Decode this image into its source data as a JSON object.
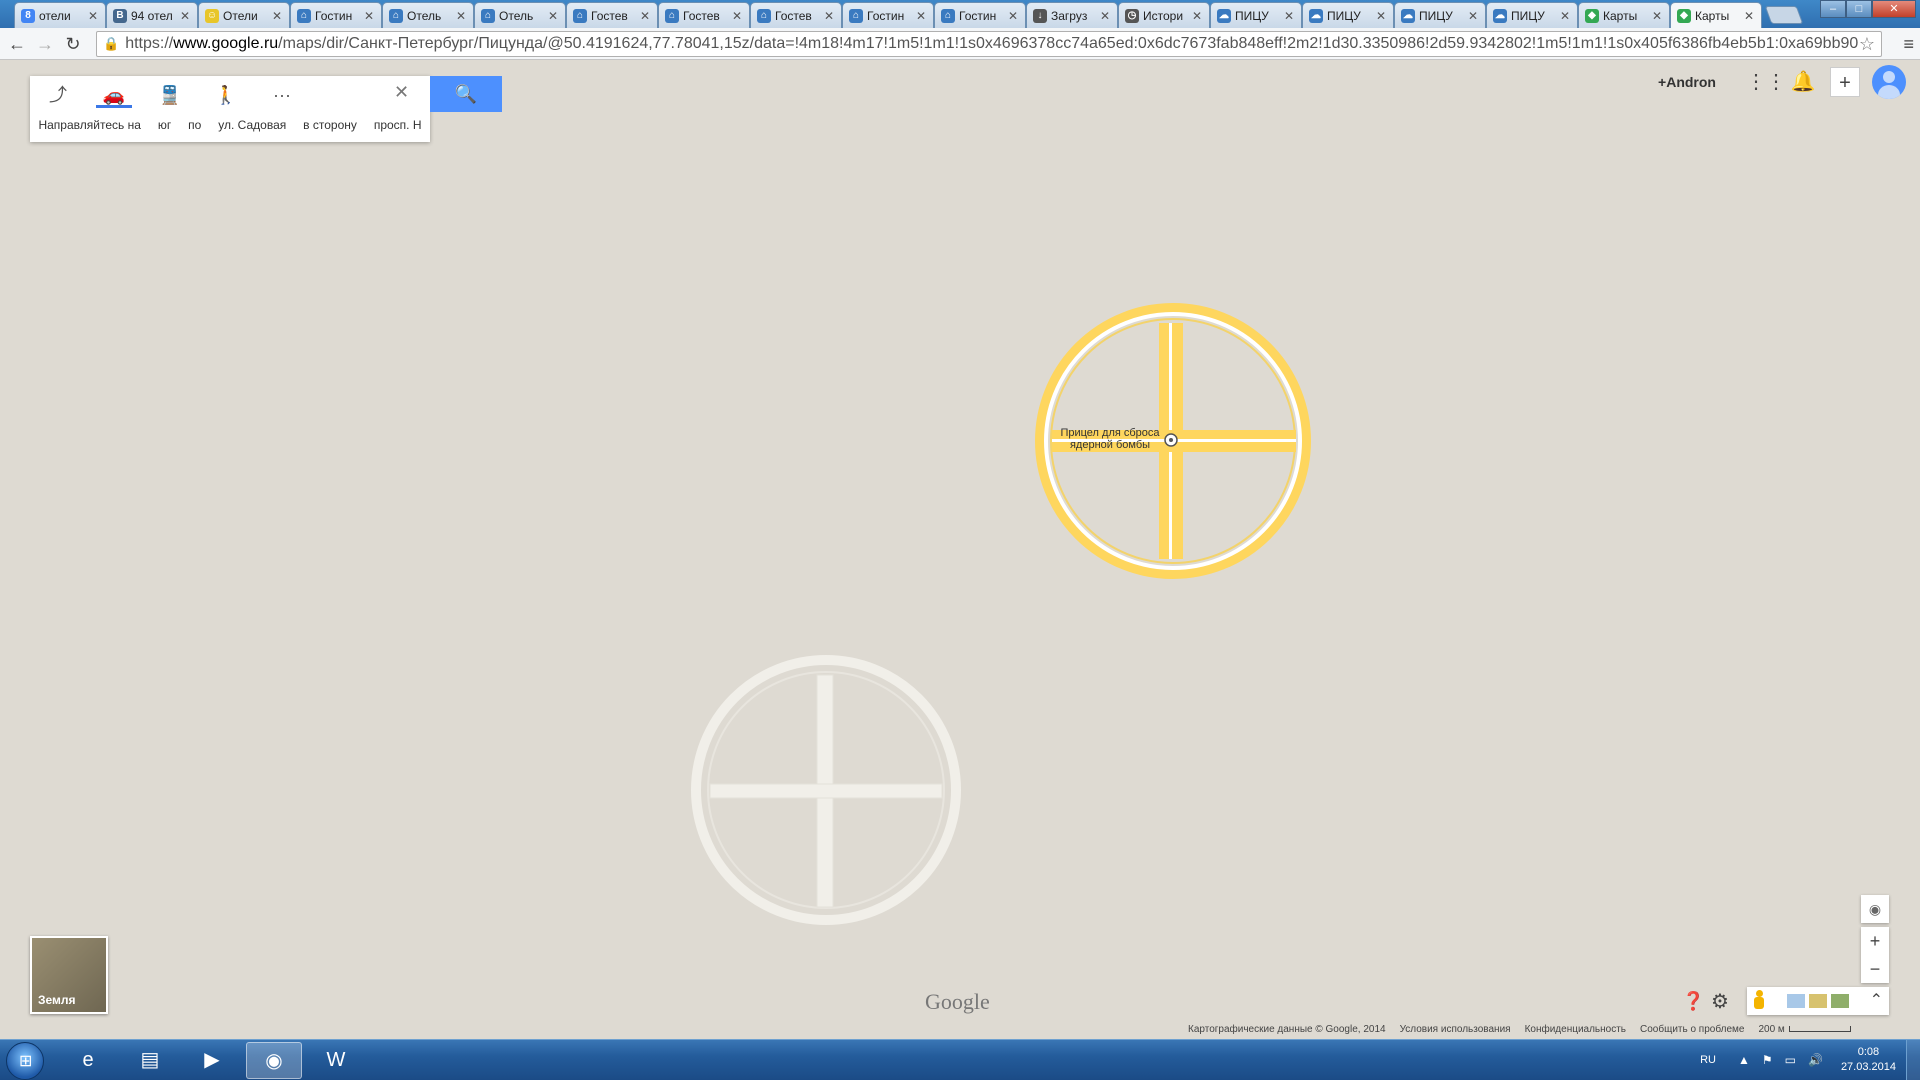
{
  "browser": {
    "tabs": [
      {
        "label": "отели",
        "icon": "google-icon",
        "color": "#4285f4",
        "glyph": "8"
      },
      {
        "label": "94 отел",
        "icon": "vk-icon",
        "color": "#45688e",
        "glyph": "B"
      },
      {
        "label": "Отели",
        "icon": "smiley-icon",
        "color": "#e8c62a",
        "glyph": "☺"
      },
      {
        "label": "Гостин",
        "icon": "hotel-icon",
        "color": "#3a7ac0",
        "glyph": "⌂"
      },
      {
        "label": "Отель",
        "icon": "hotel-icon",
        "color": "#3a7ac0",
        "glyph": "⌂"
      },
      {
        "label": "Отель",
        "icon": "hotel-icon",
        "color": "#3a7ac0",
        "glyph": "⌂"
      },
      {
        "label": "Гостев",
        "icon": "hotel-icon",
        "color": "#3a7ac0",
        "glyph": "⌂"
      },
      {
        "label": "Гостев",
        "icon": "hotel-icon",
        "color": "#3a7ac0",
        "glyph": "⌂"
      },
      {
        "label": "Гостев",
        "icon": "hotel-icon",
        "color": "#3a7ac0",
        "glyph": "⌂"
      },
      {
        "label": "Гостин",
        "icon": "hotel-icon",
        "color": "#3a7ac0",
        "glyph": "⌂"
      },
      {
        "label": "Гостин",
        "icon": "hotel-icon",
        "color": "#3a7ac0",
        "glyph": "⌂"
      },
      {
        "label": "Загруз",
        "icon": "download-icon",
        "color": "#555555",
        "glyph": "↓"
      },
      {
        "label": "Истори",
        "icon": "history-icon",
        "color": "#555555",
        "glyph": "◷"
      },
      {
        "label": "ПИЦУ",
        "icon": "cloud-icon",
        "color": "#3a7ac0",
        "glyph": "☁"
      },
      {
        "label": "ПИЦУ",
        "icon": "cloud-icon",
        "color": "#3a7ac0",
        "glyph": "☁"
      },
      {
        "label": "ПИЦУ",
        "icon": "cloud-icon",
        "color": "#3a7ac0",
        "glyph": "☁"
      },
      {
        "label": "ПИЦУ",
        "icon": "cloud-icon",
        "color": "#3a7ac0",
        "glyph": "☁"
      },
      {
        "label": "Карты",
        "icon": "maps-icon",
        "color": "#34a853",
        "glyph": "◆"
      },
      {
        "label": "Карты",
        "icon": "maps-icon",
        "color": "#34a853",
        "glyph": "◆",
        "active": true
      }
    ],
    "url_scheme": "https://",
    "url_host": "www.google.ru",
    "url_rest": "/maps/dir/Санкт-Петербург/Пицунда/@50.4191624,77.78041,15z/data=!4m18!4m17!1m5!1m1!1s0x4696378cc74a65ed:0x6dc7673fab848eff!2m2!1d30.3350986!2d59.9342802!1m5!1m1!1s0x405f6386fb4eb5b1:0xa69bb90"
  },
  "directions": {
    "modes": [
      {
        "name": "directions-icon",
        "glyph": "⤴"
      },
      {
        "name": "car-icon",
        "glyph": "🚗"
      },
      {
        "name": "transit-icon",
        "glyph": "🚆"
      },
      {
        "name": "walk-icon",
        "glyph": "🚶"
      },
      {
        "name": "more-icon",
        "glyph": "···"
      }
    ],
    "steps": [
      "Направляйтесь на",
      "юг",
      "по",
      "ул. Садовая",
      "в сторону",
      "просп. Н"
    ]
  },
  "account": {
    "user": "+Andron"
  },
  "poi": {
    "label_line1": "Прицел для сброса",
    "label_line2": "ядерной бомбы"
  },
  "earth_label": "Земля",
  "logo": "Google",
  "footer": {
    "copyright": "Картографические данные © Google, 2014",
    "terms": "Условия использования",
    "privacy": "Конфиденциальность",
    "report": "Сообщить о проблеме",
    "scale": "200 м"
  },
  "taskbar": {
    "apps": [
      {
        "name": "ie-icon",
        "glyph": "e"
      },
      {
        "name": "explorer-icon",
        "glyph": "▤"
      },
      {
        "name": "media-player-icon",
        "glyph": "▶"
      },
      {
        "name": "chrome-icon",
        "glyph": "◉",
        "active": true
      },
      {
        "name": "world-of-tanks-icon",
        "glyph": "W"
      }
    ],
    "lang": "RU",
    "time": "0:08",
    "date": "27.03.2014"
  },
  "colors": {
    "road_yellow": "#fed65e",
    "road_white": "#ffffff",
    "map_bg": "#dedad2",
    "ghost_ring": "#f1efe9"
  }
}
